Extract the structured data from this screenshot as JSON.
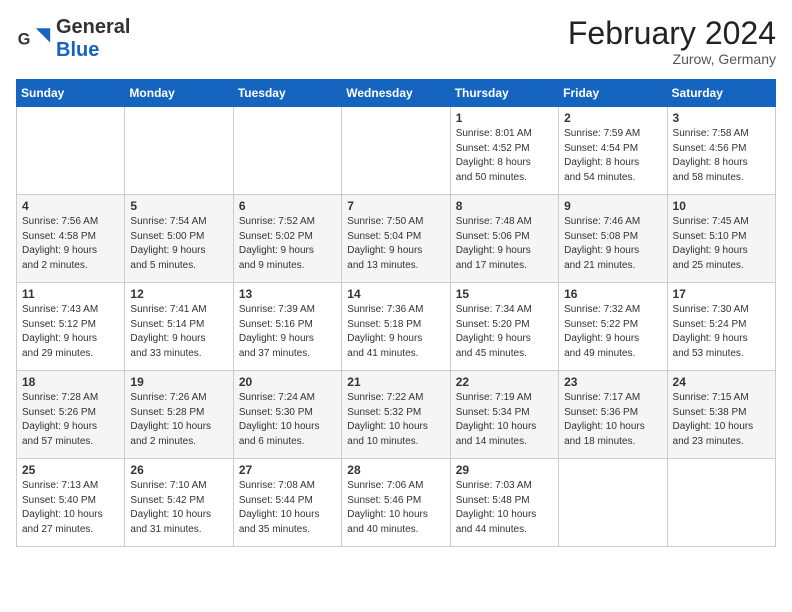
{
  "header": {
    "logo_general": "General",
    "logo_blue": "Blue",
    "month_year": "February 2024",
    "location": "Zurow, Germany"
  },
  "weekdays": [
    "Sunday",
    "Monday",
    "Tuesday",
    "Wednesday",
    "Thursday",
    "Friday",
    "Saturday"
  ],
  "weeks": [
    [
      {
        "day": "",
        "info": ""
      },
      {
        "day": "",
        "info": ""
      },
      {
        "day": "",
        "info": ""
      },
      {
        "day": "",
        "info": ""
      },
      {
        "day": "1",
        "info": "Sunrise: 8:01 AM\nSunset: 4:52 PM\nDaylight: 8 hours\nand 50 minutes."
      },
      {
        "day": "2",
        "info": "Sunrise: 7:59 AM\nSunset: 4:54 PM\nDaylight: 8 hours\nand 54 minutes."
      },
      {
        "day": "3",
        "info": "Sunrise: 7:58 AM\nSunset: 4:56 PM\nDaylight: 8 hours\nand 58 minutes."
      }
    ],
    [
      {
        "day": "4",
        "info": "Sunrise: 7:56 AM\nSunset: 4:58 PM\nDaylight: 9 hours\nand 2 minutes."
      },
      {
        "day": "5",
        "info": "Sunrise: 7:54 AM\nSunset: 5:00 PM\nDaylight: 9 hours\nand 5 minutes."
      },
      {
        "day": "6",
        "info": "Sunrise: 7:52 AM\nSunset: 5:02 PM\nDaylight: 9 hours\nand 9 minutes."
      },
      {
        "day": "7",
        "info": "Sunrise: 7:50 AM\nSunset: 5:04 PM\nDaylight: 9 hours\nand 13 minutes."
      },
      {
        "day": "8",
        "info": "Sunrise: 7:48 AM\nSunset: 5:06 PM\nDaylight: 9 hours\nand 17 minutes."
      },
      {
        "day": "9",
        "info": "Sunrise: 7:46 AM\nSunset: 5:08 PM\nDaylight: 9 hours\nand 21 minutes."
      },
      {
        "day": "10",
        "info": "Sunrise: 7:45 AM\nSunset: 5:10 PM\nDaylight: 9 hours\nand 25 minutes."
      }
    ],
    [
      {
        "day": "11",
        "info": "Sunrise: 7:43 AM\nSunset: 5:12 PM\nDaylight: 9 hours\nand 29 minutes."
      },
      {
        "day": "12",
        "info": "Sunrise: 7:41 AM\nSunset: 5:14 PM\nDaylight: 9 hours\nand 33 minutes."
      },
      {
        "day": "13",
        "info": "Sunrise: 7:39 AM\nSunset: 5:16 PM\nDaylight: 9 hours\nand 37 minutes."
      },
      {
        "day": "14",
        "info": "Sunrise: 7:36 AM\nSunset: 5:18 PM\nDaylight: 9 hours\nand 41 minutes."
      },
      {
        "day": "15",
        "info": "Sunrise: 7:34 AM\nSunset: 5:20 PM\nDaylight: 9 hours\nand 45 minutes."
      },
      {
        "day": "16",
        "info": "Sunrise: 7:32 AM\nSunset: 5:22 PM\nDaylight: 9 hours\nand 49 minutes."
      },
      {
        "day": "17",
        "info": "Sunrise: 7:30 AM\nSunset: 5:24 PM\nDaylight: 9 hours\nand 53 minutes."
      }
    ],
    [
      {
        "day": "18",
        "info": "Sunrise: 7:28 AM\nSunset: 5:26 PM\nDaylight: 9 hours\nand 57 minutes."
      },
      {
        "day": "19",
        "info": "Sunrise: 7:26 AM\nSunset: 5:28 PM\nDaylight: 10 hours\nand 2 minutes."
      },
      {
        "day": "20",
        "info": "Sunrise: 7:24 AM\nSunset: 5:30 PM\nDaylight: 10 hours\nand 6 minutes."
      },
      {
        "day": "21",
        "info": "Sunrise: 7:22 AM\nSunset: 5:32 PM\nDaylight: 10 hours\nand 10 minutes."
      },
      {
        "day": "22",
        "info": "Sunrise: 7:19 AM\nSunset: 5:34 PM\nDaylight: 10 hours\nand 14 minutes."
      },
      {
        "day": "23",
        "info": "Sunrise: 7:17 AM\nSunset: 5:36 PM\nDaylight: 10 hours\nand 18 minutes."
      },
      {
        "day": "24",
        "info": "Sunrise: 7:15 AM\nSunset: 5:38 PM\nDaylight: 10 hours\nand 23 minutes."
      }
    ],
    [
      {
        "day": "25",
        "info": "Sunrise: 7:13 AM\nSunset: 5:40 PM\nDaylight: 10 hours\nand 27 minutes."
      },
      {
        "day": "26",
        "info": "Sunrise: 7:10 AM\nSunset: 5:42 PM\nDaylight: 10 hours\nand 31 minutes."
      },
      {
        "day": "27",
        "info": "Sunrise: 7:08 AM\nSunset: 5:44 PM\nDaylight: 10 hours\nand 35 minutes."
      },
      {
        "day": "28",
        "info": "Sunrise: 7:06 AM\nSunset: 5:46 PM\nDaylight: 10 hours\nand 40 minutes."
      },
      {
        "day": "29",
        "info": "Sunrise: 7:03 AM\nSunset: 5:48 PM\nDaylight: 10 hours\nand 44 minutes."
      },
      {
        "day": "",
        "info": ""
      },
      {
        "day": "",
        "info": ""
      }
    ]
  ]
}
